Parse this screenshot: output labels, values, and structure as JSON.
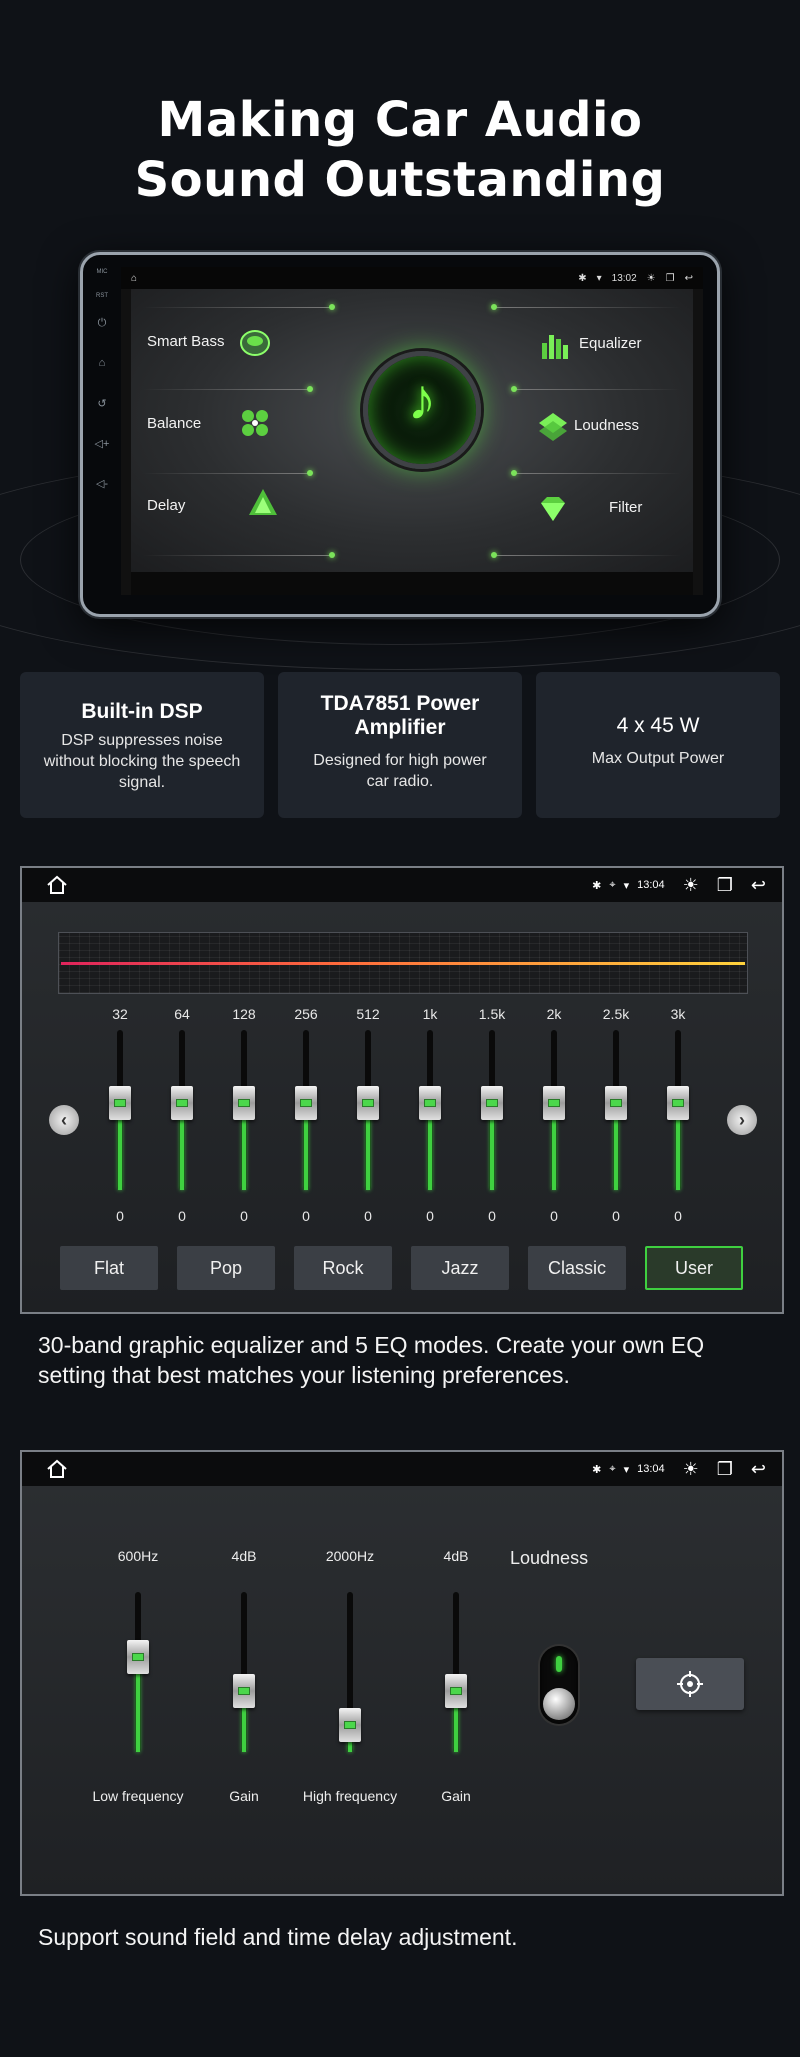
{
  "hero": {
    "title_line1": "Making Car Audio",
    "title_line2": "Sound Outstanding"
  },
  "tablet": {
    "side_labels": {
      "mic": "MIC",
      "rst": "RST"
    },
    "time": "13:02",
    "menu_left": [
      "Smart Bass",
      "Balance",
      "Delay"
    ],
    "menu_right": [
      "Equalizer",
      "Loudness",
      "Filter"
    ],
    "center_icon": "music-note-icon"
  },
  "features": [
    {
      "title": "Built-in DSP",
      "text": "DSP suppresses noise without blocking the speech signal."
    },
    {
      "title": "TDA7851 Power Amplifier",
      "text": "Designed for high power car radio."
    },
    {
      "title": "4 x 45 W",
      "text": "Max Output Power"
    }
  ],
  "eq_panel": {
    "time": "13:04",
    "bands": [
      {
        "freq": "32",
        "value": "0"
      },
      {
        "freq": "64",
        "value": "0"
      },
      {
        "freq": "128",
        "value": "0"
      },
      {
        "freq": "256",
        "value": "0"
      },
      {
        "freq": "512",
        "value": "0"
      },
      {
        "freq": "1k",
        "value": "0"
      },
      {
        "freq": "1.5k",
        "value": "0"
      },
      {
        "freq": "2k",
        "value": "0"
      },
      {
        "freq": "2.5k",
        "value": "0"
      },
      {
        "freq": "3k",
        "value": "0"
      }
    ],
    "modes": [
      "Flat",
      "Pop",
      "Rock",
      "Jazz",
      "Classic",
      "User"
    ],
    "active_mode": "User",
    "arrow_prev": "‹",
    "arrow_next": "›"
  },
  "eq_caption": "30-band graphic equalizer and 5 EQ modes. Create your own EQ setting that best matches your listening preferences.",
  "loudness_panel": {
    "time": "13:04",
    "sliders": [
      {
        "top_label": "600Hz",
        "bottom_label": "Low frequency",
        "level": 0.62
      },
      {
        "top_label": "4dB",
        "bottom_label": "Gain",
        "level": 0.35
      },
      {
        "top_label": "2000Hz",
        "bottom_label": "High frequency",
        "level": 0.08
      },
      {
        "top_label": "4dB",
        "bottom_label": "Gain",
        "level": 0.35
      }
    ],
    "loudness_label": "Loudness",
    "loudness_on": true
  },
  "loudness_caption": "Support sound field and time delay adjustment.",
  "colors": {
    "accent": "#3fd040",
    "card_bg": "#1f242c",
    "page_bg": "#0f1217"
  }
}
